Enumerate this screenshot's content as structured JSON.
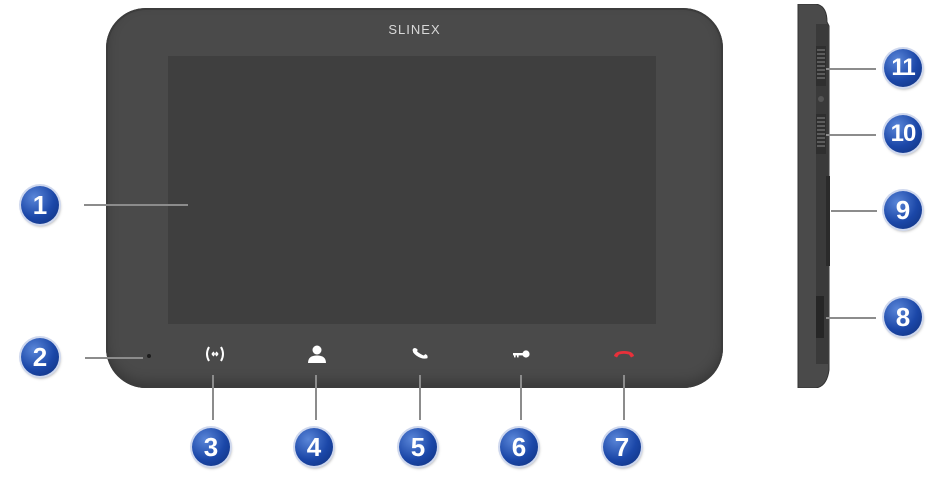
{
  "device": {
    "brand": "SLINEX",
    "colors": {
      "body": "#4a4a4a",
      "screen": "#3f3f3f",
      "icon": "#ffffff",
      "hangup_icon": "#e8303a",
      "badge": "#1b47a8"
    }
  },
  "buttons": [
    {
      "id": "3",
      "icon": "swap-arrows-icon"
    },
    {
      "id": "4",
      "icon": "user-icon"
    },
    {
      "id": "5",
      "icon": "phone-handset-icon"
    },
    {
      "id": "6",
      "icon": "key-icon"
    },
    {
      "id": "7",
      "icon": "hang-up-icon"
    }
  ],
  "callouts": {
    "c1": "1",
    "c2": "2",
    "c3": "3",
    "c4": "4",
    "c5": "5",
    "c6": "6",
    "c7": "7",
    "c8": "8",
    "c9": "9",
    "c10": "10",
    "c11": "11"
  }
}
